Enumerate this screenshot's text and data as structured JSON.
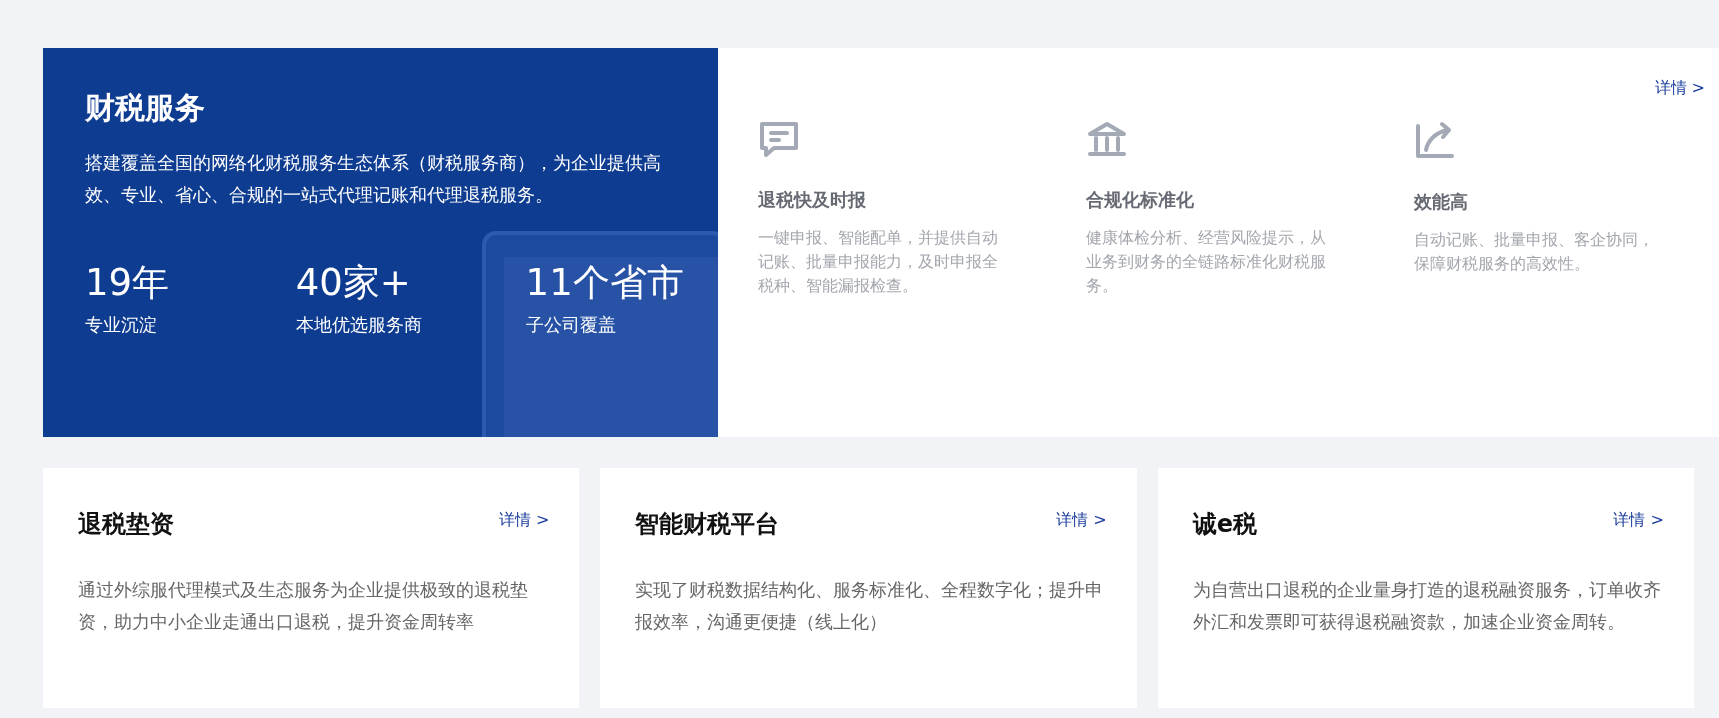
{
  "hero": {
    "title": "财税服务",
    "description": "搭建覆盖全国的网络化财税服务生态体系（财税服务商），为企业提供高效、专业、省心、合规的一站式代理记账和代理退税服务。",
    "stats": [
      {
        "value": "19年",
        "label": "专业沉淀"
      },
      {
        "value": "40家+",
        "label": "本地优选服务商"
      },
      {
        "value": "11个省市",
        "label": "子公司覆盖"
      }
    ]
  },
  "features": {
    "link": "详情 >",
    "items": [
      {
        "kind": "message",
        "title": "退税快及时报",
        "description": "一键申报、智能配单，并提供自动记账、批量申报能力，及时申报全税种、智能漏报检查。"
      },
      {
        "kind": "bank",
        "title": "合规化标准化",
        "description": "健康体检分析、经营风险提示，从业务到财务的全链路标准化财税服务。"
      },
      {
        "kind": "growth",
        "title": "效能高",
        "description": "自动记账、批量申报、客企协同，保障财税服务的高效性。"
      }
    ]
  },
  "cards": [
    {
      "title": "退税垫资",
      "link": "详情 >",
      "description": "通过外综服代理模式及生态服务为企业提供极致的退税垫资，助力中小企业走通出口退税，提升资金周转率"
    },
    {
      "title": "智能财税平台",
      "link": "详情 >",
      "description": "实现了财税数据结构化、服务标准化、全程数字化；提升申报效率，沟通更便捷（线上化）"
    },
    {
      "title": "诚e税",
      "link": "详情 >",
      "description": "为自营出口退税的企业量身打造的退税融资服务，订单收齐外汇和发票即可获得退税融资款，加速企业资金周转。"
    }
  ]
}
